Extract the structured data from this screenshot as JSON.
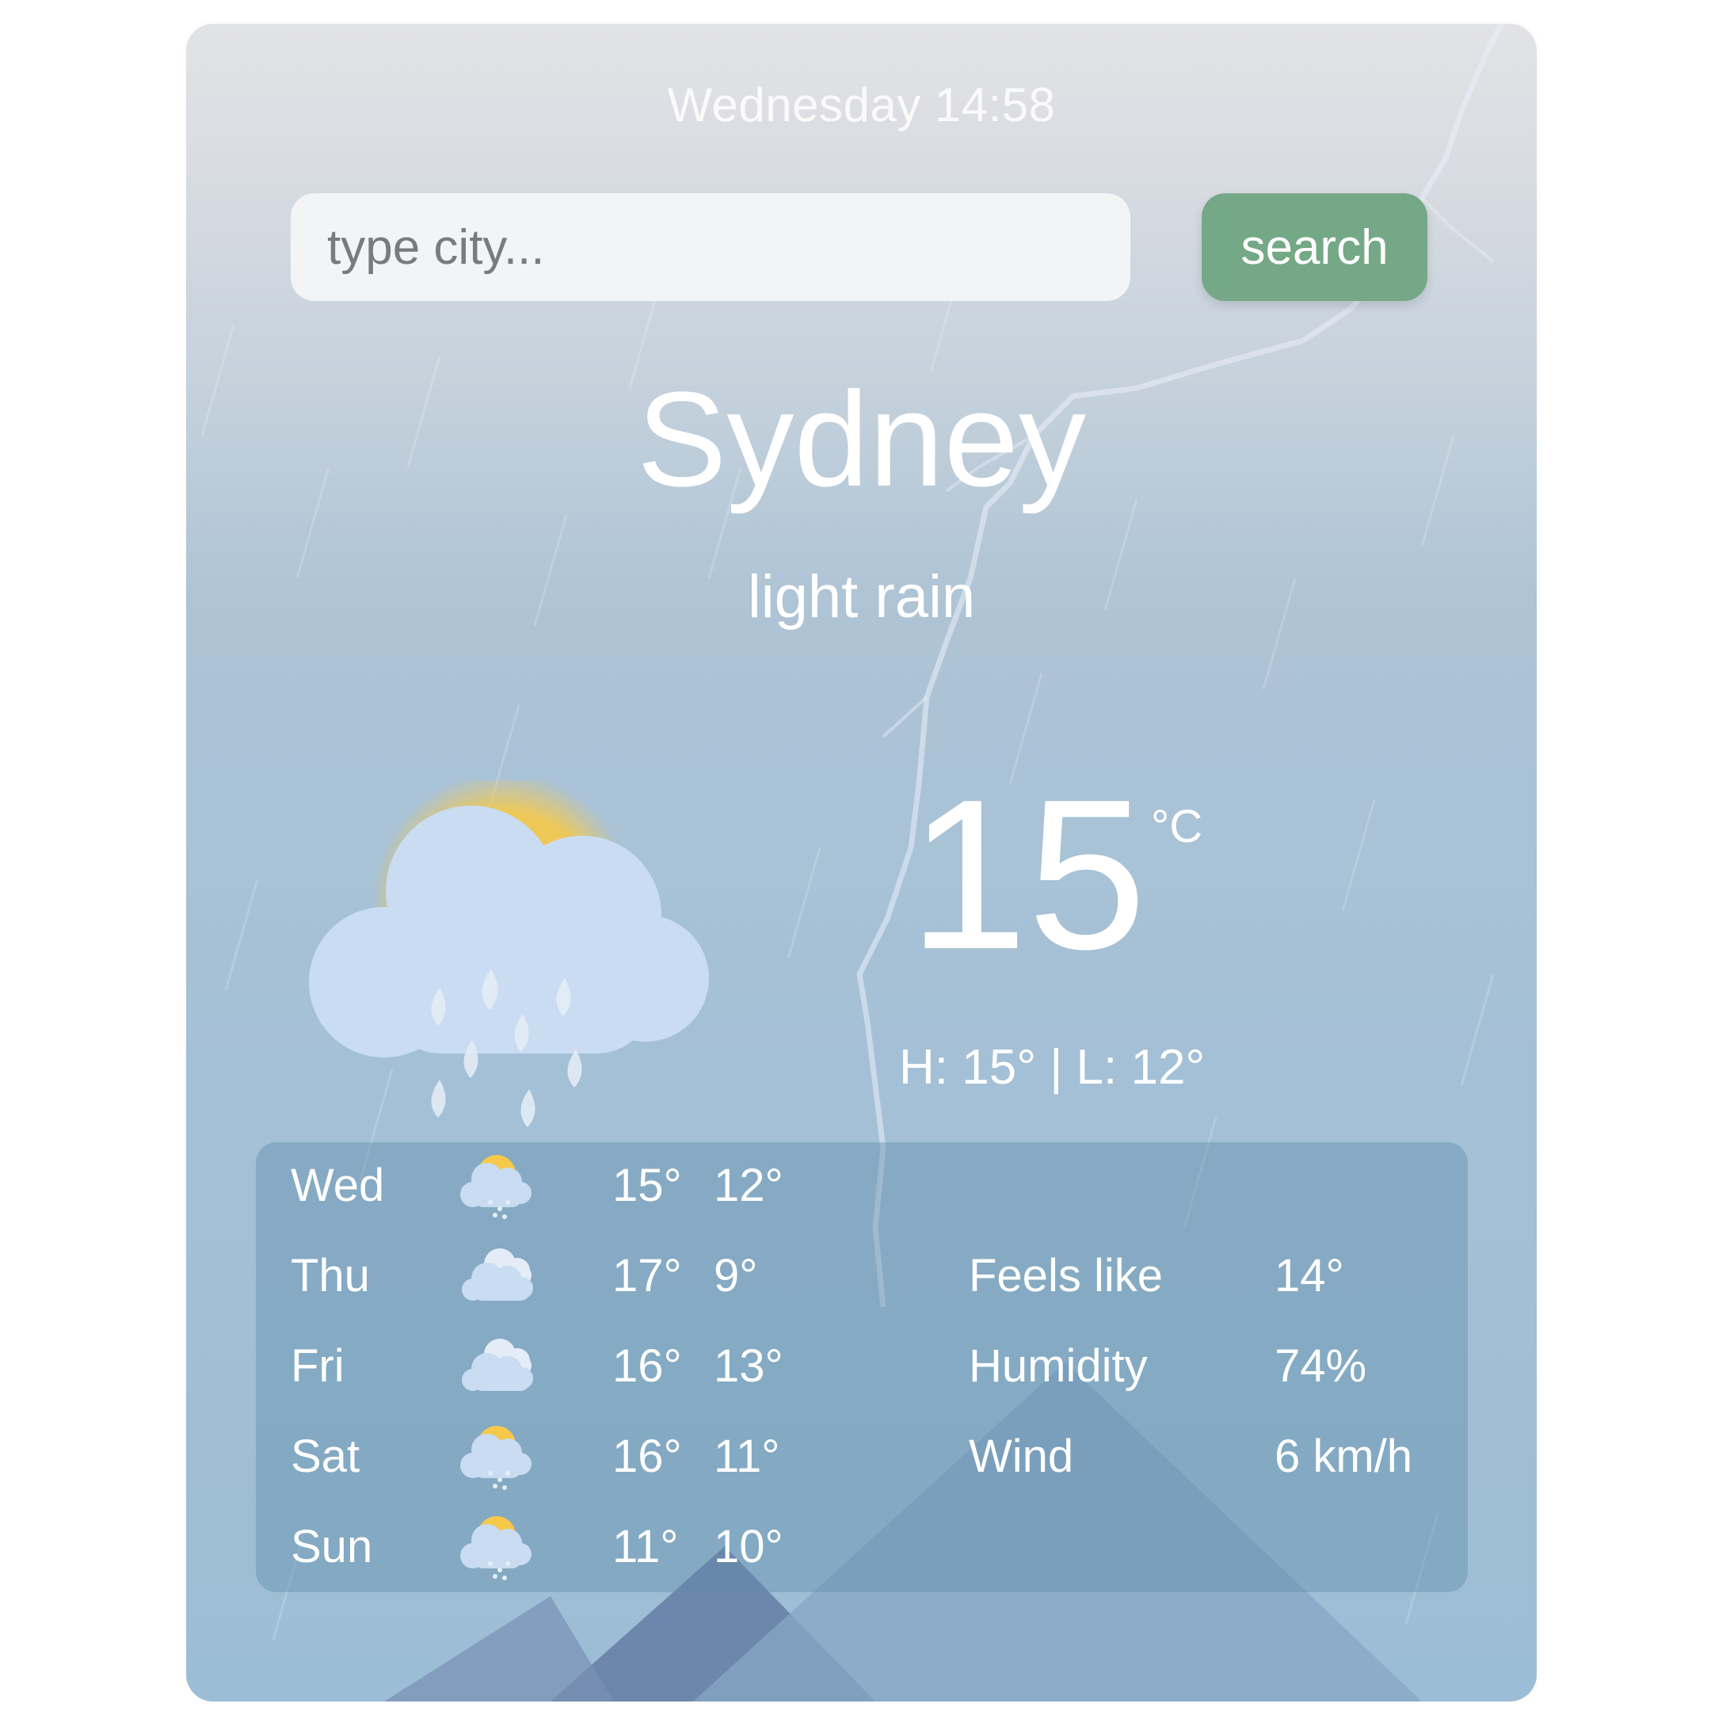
{
  "header": {
    "datetime": "Wednesday 14:58"
  },
  "search": {
    "placeholder": "type city...",
    "value": "",
    "button_label": "search",
    "button_color": "#75a886"
  },
  "current": {
    "city": "Sydney",
    "condition": "light rain",
    "temperature": "15",
    "unit": "°C",
    "hilo": "H: 15° | L: 12°",
    "icon": "sun-cloud-rain-icon"
  },
  "forecast": [
    {
      "day": "Wed",
      "icon": "sun-cloud-rain-icon",
      "high": "15°",
      "low": "12°"
    },
    {
      "day": "Thu",
      "icon": "clouds-icon",
      "high": "17°",
      "low": "9°"
    },
    {
      "day": "Fri",
      "icon": "clouds-icon",
      "high": "16°",
      "low": "13°"
    },
    {
      "day": "Sat",
      "icon": "sun-cloud-rain-icon",
      "high": "16°",
      "low": "11°"
    },
    {
      "day": "Sun",
      "icon": "sun-cloud-rain-icon",
      "high": "11°",
      "low": "10°"
    }
  ],
  "stats": [
    {
      "label": "Feels like",
      "value": "14°"
    },
    {
      "label": "Humidity",
      "value": "74%"
    },
    {
      "label": "Wind",
      "value": "6 km/h"
    }
  ]
}
